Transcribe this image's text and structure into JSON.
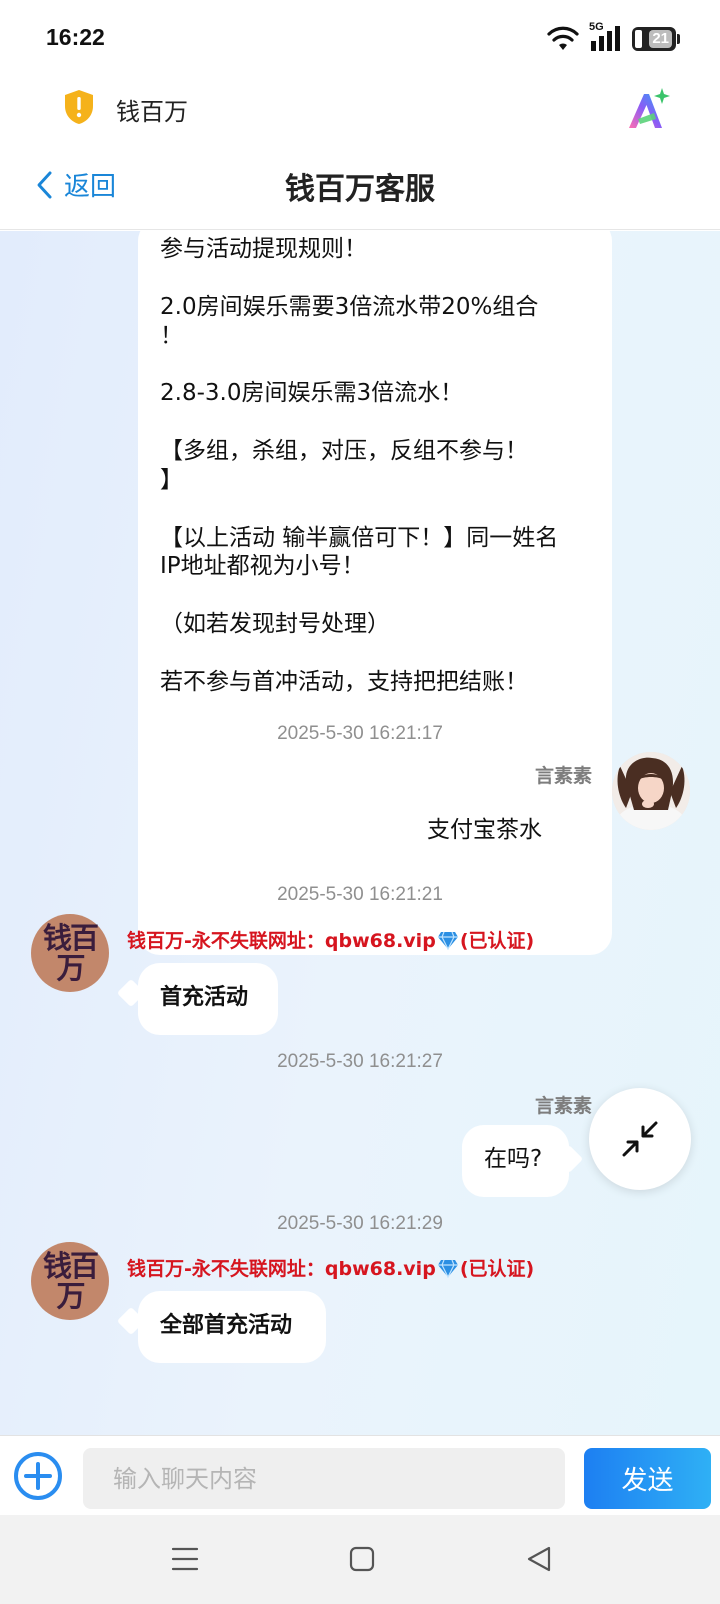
{
  "status_bar": {
    "time": "16:22",
    "network": "5G",
    "battery": "21"
  },
  "app_bar": {
    "app_name": "钱百万"
  },
  "nav": {
    "back_label": "返回",
    "title": "钱百万客服"
  },
  "messages": {
    "m1": {
      "paragraphs": [
        "参与活动提现规则！",
        "2.0房间娱乐需要3倍流水带20%组合\n！",
        "2.8-3.0房间娱乐需3倍流水！",
        "【多组，杀组，对压，反组不参与！\n】",
        "【以上活动 输半赢倍可下！】同一姓名\nIP地址都视为小号！",
        "（如若发现封号处理）",
        "若不参与首冲活动，支持把把结账！"
      ]
    },
    "m2": {
      "time": "2025-5-30 16:21:17",
      "sender": "言素素",
      "text": "支付宝茶水"
    },
    "m3": {
      "time": "2025-5-30 16:21:21",
      "sender_prefix": "钱百万-永不失联网址：qbw68.vip",
      "sender_suffix": "(已认证)",
      "text": "首充活动"
    },
    "m4": {
      "time": "2025-5-30 16:21:27",
      "sender": "言素素",
      "text": "在吗?"
    },
    "m5": {
      "time": "2025-5-30 16:21:29",
      "sender_prefix": "钱百万-永不失联网址：qbw68.vip",
      "sender_suffix": "(已认证)",
      "text": "全部首充活动"
    }
  },
  "bot_avatar": {
    "line1": "钱百",
    "line2": "万"
  },
  "input": {
    "placeholder": "输入聊天内容",
    "value": ""
  },
  "send_label": "发送",
  "colors": {
    "accent": "#1a86d8",
    "send_start": "#1d7ff2",
    "send_end": "#2fb0f5",
    "sender_red": "#d6151f",
    "diamond": "#2b8fe3"
  }
}
